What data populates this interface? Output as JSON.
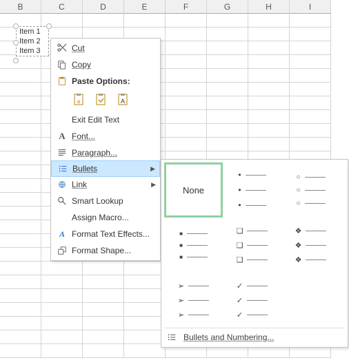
{
  "columns": [
    "B",
    "C",
    "D",
    "E",
    "F",
    "G",
    "H",
    "I"
  ],
  "textbox": {
    "items": [
      "Item 1",
      "Item 2",
      "Item 3"
    ]
  },
  "menu": {
    "cut": "Cut",
    "copy": "Copy",
    "paste_options": "Paste Options:",
    "exit_edit": "Exit Edit Text",
    "font": "Font...",
    "paragraph": "Paragraph...",
    "bullets": "Bullets",
    "link": "Link",
    "smart_lookup": "Smart Lookup",
    "assign_macro": "Assign Macro...",
    "format_text_effects": "Format Text Effects...",
    "format_shape": "Format Shape..."
  },
  "gallery": {
    "none": "None",
    "footer": "Bullets and Numbering...",
    "styles": [
      "none",
      "disc",
      "circle",
      "square",
      "hollow-square",
      "diamond",
      "arrow",
      "check"
    ]
  }
}
